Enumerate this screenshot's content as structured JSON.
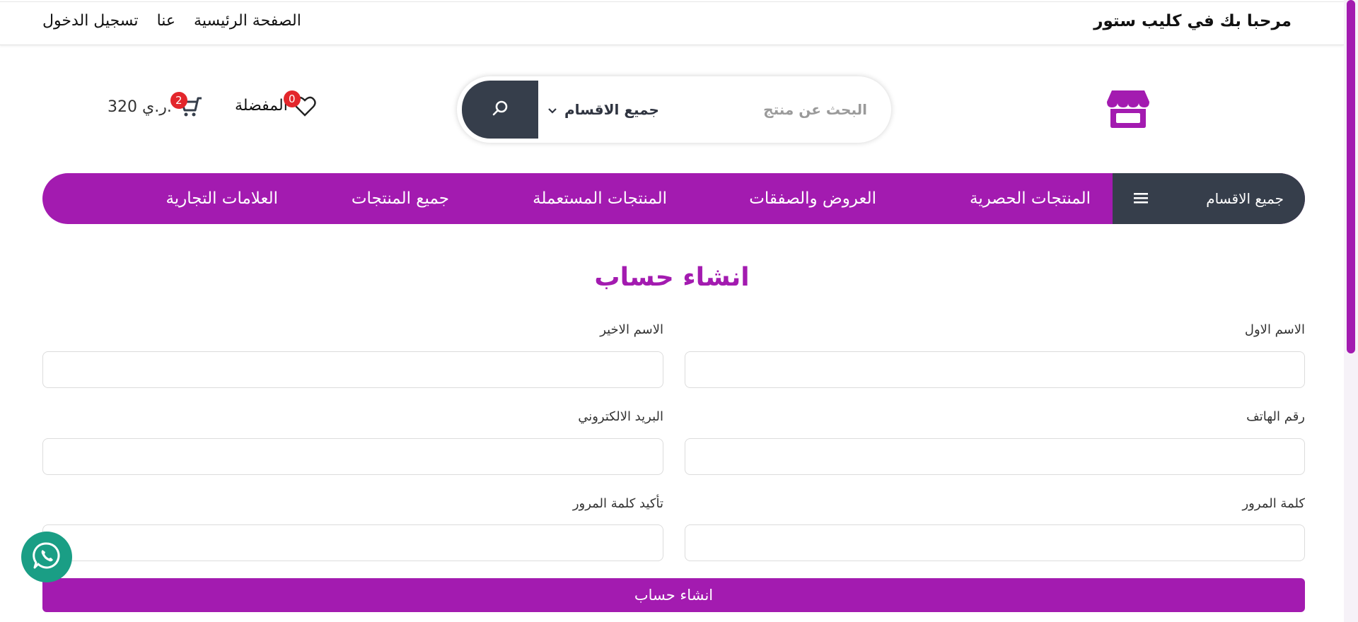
{
  "topbar": {
    "welcome": "مرحبا بك في كليب ستور",
    "links": [
      "الصفحة الرئيسية",
      "عنا",
      "تسجيل الدخول"
    ]
  },
  "header": {
    "logo_icon": "store-icon",
    "search": {
      "placeholder": "البحث عن منتج",
      "category": "جميع الاقسام",
      "button_icon": "search-icon"
    },
    "wishlist": {
      "label": "المفضلة",
      "count": "0"
    },
    "cart": {
      "total": "320 ر.ي.",
      "count": "2"
    }
  },
  "nav": {
    "all_categories": "جميع الاقسام",
    "items": [
      "المنتجات الحصرية",
      "العروض والصفقات",
      "المنتجات المستعملة",
      "جميع المنتجات",
      "العلامات التجارية"
    ]
  },
  "form": {
    "title": "انشاء حساب",
    "first_name": "الاسم الاول",
    "last_name": "الاسم الاخير",
    "phone": "رقم الهاتف",
    "email": "البريد الالكتروني",
    "password": "كلمة المرور",
    "confirm_password": "تأكيد كلمة المرور",
    "submit": "انشاء حساب"
  },
  "colors": {
    "brand": "#a31bb0",
    "dark": "#363e4b",
    "badge": "#e3262b",
    "whatsapp": "#1a9e85"
  }
}
